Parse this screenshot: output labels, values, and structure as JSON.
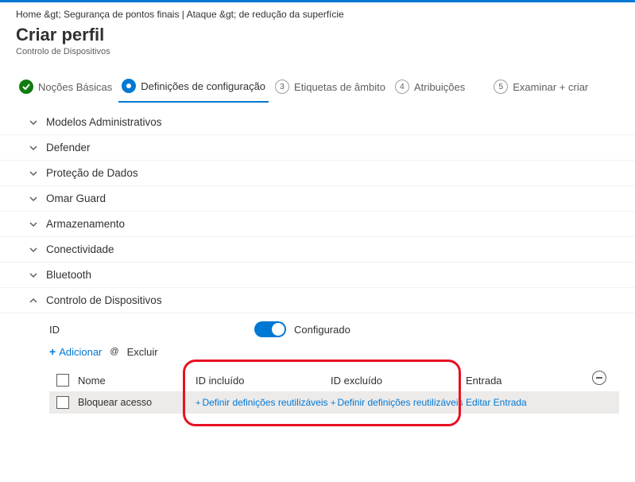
{
  "breadcrumb": "Home &gt;  Segurança de pontos finais | Ataque &gt; de redução da superfície",
  "page": {
    "title": "Criar perfil",
    "subtitle": "Controlo de Dispositivos"
  },
  "steps": {
    "s1": "Noções Básicas",
    "s2": "Definições de configuração",
    "s3": "Etiquetas de âmbito",
    "s4": "Atribuições",
    "s5_num": "5",
    "s5": "Examinar + criar"
  },
  "sections": {
    "a": "Modelos Administrativos",
    "b": "Defender",
    "c": "Proteção de Dados",
    "d": "Omar Guard",
    "e": "Armazenamento",
    "f": "Conectividade",
    "g": "Bluetooth",
    "h": "Controlo de Dispositivos"
  },
  "device": {
    "id_label": "ID",
    "toggle_label": "Configurado",
    "add_label": "Adicionar",
    "at": "@",
    "exclude_label": "Excluir",
    "columns": {
      "name": "Nome",
      "inc": "ID incluído",
      "exc": "ID excluído",
      "entry": "Entrada"
    },
    "row": {
      "name": "Bloquear acesso",
      "inc": "Definir definições reutilizáveis",
      "exc": "Definir definições reutilizáveis",
      "entry": "Editar Entrada"
    }
  }
}
